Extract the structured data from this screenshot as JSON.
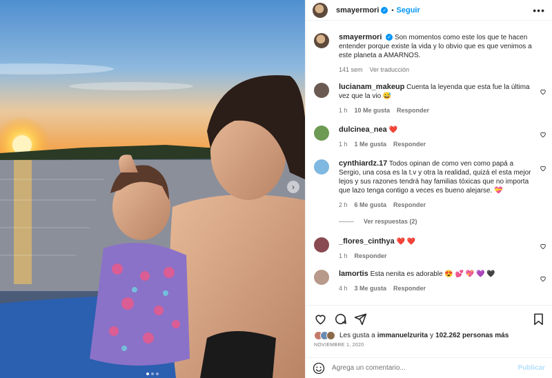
{
  "post": {
    "author": "smayermori",
    "follow_label": "Seguir",
    "separator": "•",
    "more_label": "•••",
    "caption": "Son momentos como este los que te hacen entender porque existe la vida y lo obvio que es que venimos a este planeta a AMARNOS.",
    "caption_age": "141 sem",
    "translate_label": "Ver traducción"
  },
  "comments": [
    {
      "user": "lucianam_makeup",
      "text": "Cuenta la leyenda que esta fue la última vez que la vio 😅",
      "age": "1 h",
      "likes": "10 Me gusta",
      "reply": "Responder"
    },
    {
      "user": "dulcinea_nea",
      "text": "❤️",
      "age": "1 h",
      "likes": "1 Me gusta",
      "reply": "Responder"
    },
    {
      "user": "cynthiardz.17",
      "text": "Todos opinan de como ven como papá a Sergio, una cosa es la t.v y otra la realidad, quizá el esta mejor lejos y sus razones tendrá hay familias tóxicas que no importa que lazo tenga contigo a veces es bueno alejarse. 💝",
      "age": "2 h",
      "likes": "6 Me gusta",
      "reply": "Responder",
      "view_replies": "Ver respuestas (2)"
    },
    {
      "user": "_flores_cinthya",
      "text": "❤️ ❤️",
      "age": "1 h",
      "likes": "",
      "reply": "Responder"
    },
    {
      "user": "lamortis",
      "text": "Esta nenita es adorable 😍 💕 💖 💜 🖤",
      "age": "4 h",
      "likes": "3 Me gusta",
      "reply": "Responder"
    }
  ],
  "likes": {
    "prefix": "Les gusta a",
    "user": "immanuelzurita",
    "joiner": "y",
    "count": "102.262 personas más"
  },
  "date": "NOVIEMBRE 1, 2020",
  "add_comment": {
    "placeholder": "Agrega un comentario...",
    "publish_label": "Publicar"
  },
  "carousel": {
    "next_icon": "›",
    "dots": 3,
    "active_dot": 0
  },
  "colors": {
    "accent": "#0095f6",
    "muted": "#737373",
    "text": "#262626",
    "publish_disabled": "#b2dffc"
  }
}
